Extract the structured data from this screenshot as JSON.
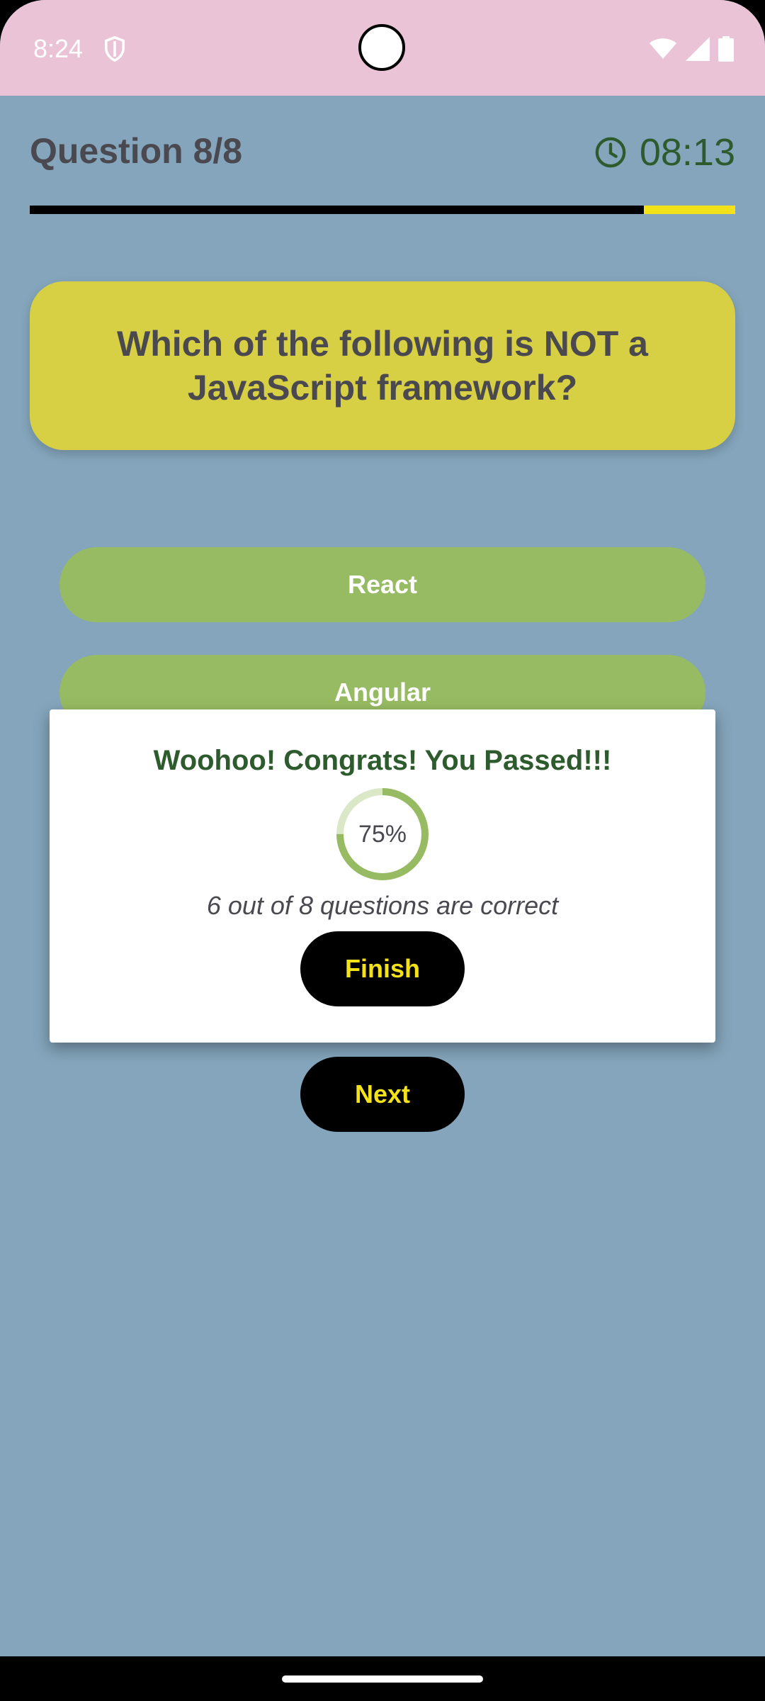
{
  "status_bar": {
    "time": "8:24",
    "icons": [
      "shield-icon",
      "wifi-icon",
      "signal-icon",
      "battery-icon"
    ]
  },
  "header": {
    "question_counter": "Question 8/8",
    "timer": "08:13",
    "timer_icon": "clock-icon",
    "progress": 0.87
  },
  "question": {
    "text": "Which of the following is NOT a JavaScript framework?"
  },
  "options": [
    {
      "label": "React"
    },
    {
      "label": "Angular"
    }
  ],
  "next_button": {
    "label": "Next"
  },
  "dialog": {
    "title": "Woohoo! Congrats! You Passed!!!",
    "score_percent_label": "75%",
    "score_fraction": 0.75,
    "result_text": "6 out of 8 questions are correct",
    "finish_label": "Finish"
  },
  "colors": {
    "background": "#84a5bb",
    "status_bar": "#ebc3d6",
    "question_card": "#d7cf44",
    "option": "#97bb62",
    "accent_yellow": "#f3e21a",
    "dark_green": "#2e5b2e"
  }
}
